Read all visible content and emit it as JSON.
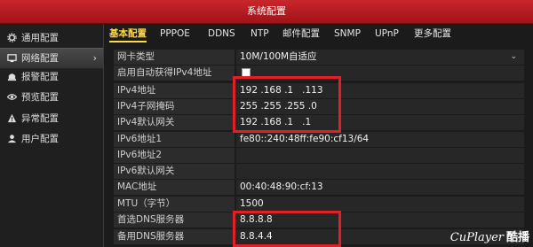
{
  "window": {
    "title": "系统配置"
  },
  "sidebar": {
    "items": [
      {
        "label": "通用配置",
        "icon": "gear-icon"
      },
      {
        "label": "网络配置",
        "icon": "network-icon",
        "arrow": "›"
      },
      {
        "label": "报警配置",
        "icon": "alarm-icon"
      },
      {
        "label": "预览配置",
        "icon": "eye-icon"
      },
      {
        "label": "异常配置",
        "icon": "warning-icon"
      },
      {
        "label": "用户配置",
        "icon": "user-icon"
      }
    ]
  },
  "tabs": [
    "基本配置",
    "PPPOE",
    "DDNS",
    "NTP",
    "邮件配置",
    "SNMP",
    "UPnP",
    "更多配置"
  ],
  "form": {
    "nic_type": {
      "label": "网卡类型",
      "value": "10M/100M自适应"
    },
    "dhcp": {
      "label": "启用自动获得IPv4地址",
      "checked": false
    },
    "ipv4_addr": {
      "label": "IPv4地址",
      "value": "192 .168 .1   .113"
    },
    "ipv4_mask": {
      "label": "IPv4子网掩码",
      "value": "255 .255 .255 .0"
    },
    "ipv4_gw": {
      "label": "IPv4默认网关",
      "value": "192 .168 .1   .1"
    },
    "ipv6_addr1": {
      "label": "IPv6地址1",
      "value": "fe80::240:48ff:fe90:cf13/64"
    },
    "ipv6_addr2": {
      "label": "IPv6地址2",
      "value": ""
    },
    "ipv6_gw": {
      "label": "IPv6默认网关",
      "value": ""
    },
    "mac": {
      "label": "MAC地址",
      "value": "00:40:48:90:cf:13"
    },
    "mtu": {
      "label": "MTU（字节）",
      "value": "1500"
    },
    "dns1": {
      "label": "首选DNS服务器",
      "value": "8.8.8.8"
    },
    "dns2": {
      "label": "备用DNS服务器",
      "value": "8.8.4.4"
    }
  },
  "watermark": {
    "text": "CuPlayer",
    "cn": "酷播"
  },
  "colors": {
    "title_bar": "#b51c22",
    "highlight": "#e01f26",
    "active_tab": "#ffd84a"
  }
}
